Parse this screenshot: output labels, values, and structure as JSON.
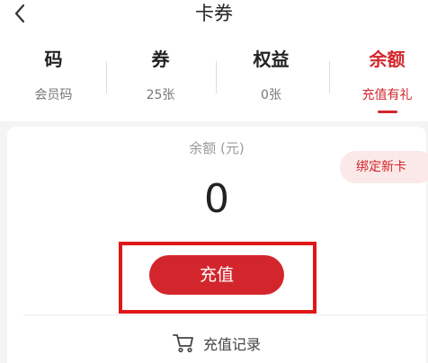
{
  "header": {
    "title": "卡券"
  },
  "tabs": [
    {
      "title": "码",
      "subtitle": "会员码"
    },
    {
      "title": "券",
      "subtitle": "25张"
    },
    {
      "title": "权益",
      "subtitle": "0张"
    },
    {
      "title": "余额",
      "subtitle": "充值有礼"
    }
  ],
  "balance": {
    "label": "余额 (元)",
    "value": "0",
    "bind_label": "绑定新卡",
    "recharge_label": "充值",
    "record_label": "充值记录"
  },
  "colors": {
    "accent": "#d3262c",
    "highlight": "#e01818"
  },
  "icons": {
    "back": "chevron-left-icon",
    "record": "cart-icon"
  }
}
